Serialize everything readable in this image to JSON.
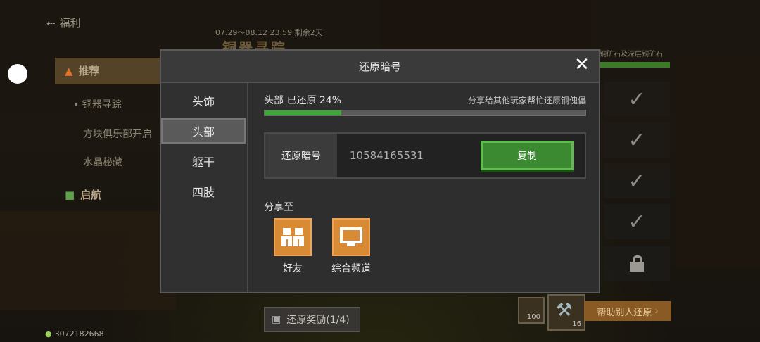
{
  "background": {
    "back_label": "福利",
    "menu": {
      "recommend": "推荐",
      "items": [
        "铜器寻踪",
        "方块俱乐部开启",
        "水晶秘藏"
      ],
      "launch": "启航"
    },
    "event_date": "07.29～08.12 23:59 剩余2天",
    "event_title": "铜器寻踪",
    "right_note": "铜矿石及深层铜矿石",
    "reward_button": "还原奖励(1/4)",
    "slot1_count": "100",
    "slot2_count": "16",
    "help_button": "帮助别人还原",
    "network_id": "3072182668"
  },
  "modal": {
    "title": "还原暗号",
    "tabs": [
      "头饰",
      "头部",
      "躯干",
      "四肢"
    ],
    "active_tab": "头部",
    "progress_label": "头部 已还原 24%",
    "progress_percent": 24,
    "share_hint": "分享给其他玩家帮忙还原铜傀儡",
    "code_label": "还原暗号",
    "code_value": "10584165531",
    "copy_button": "复制",
    "share_title": "分享至",
    "share_targets": [
      {
        "label": "好友",
        "icon": "friends-icon"
      },
      {
        "label": "综合频道",
        "icon": "monitor-icon"
      }
    ]
  },
  "colors": {
    "accent_green": "#3fa73a",
    "share_orange": "#d98a34"
  }
}
